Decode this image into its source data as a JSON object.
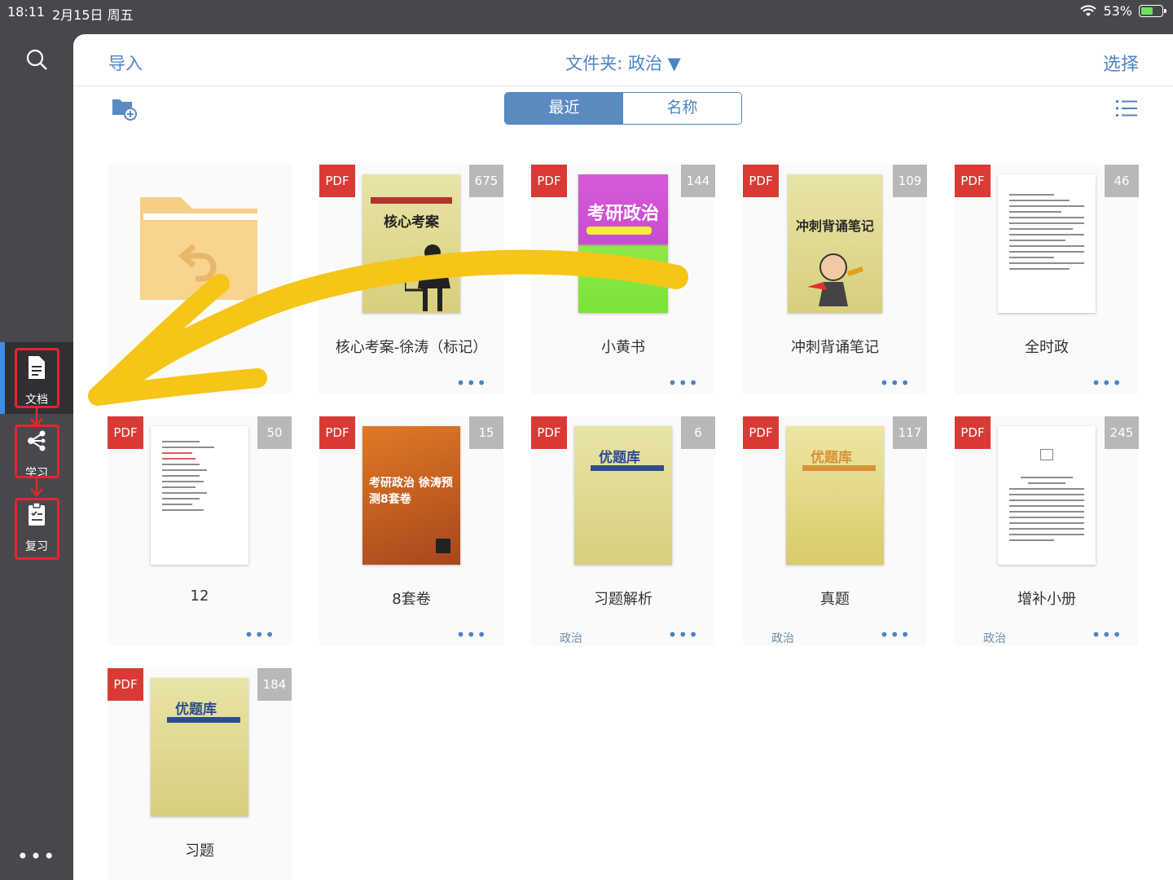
{
  "status": {
    "time": "18:11",
    "date": "2月15日 周五",
    "battery": "53%"
  },
  "sidebar": {
    "items": [
      {
        "label": "文档"
      },
      {
        "label": "学习"
      },
      {
        "label": "复习"
      }
    ],
    "more": "•••"
  },
  "toolbar": {
    "import": "导入",
    "folder": "文件夹: 政治 ▼",
    "select": "选择",
    "sort_recent": "最近",
    "sort_name": "名称"
  },
  "docs": [
    {
      "title": "核心考案-徐涛（标记）",
      "badge": "PDF",
      "pages": "675",
      "tag": "",
      "cover": "核心考案"
    },
    {
      "title": "小黄书",
      "badge": "PDF",
      "pages": "144",
      "tag": "",
      "cover": "考研政治"
    },
    {
      "title": "冲刺背诵笔记",
      "badge": "PDF",
      "pages": "109",
      "tag": "",
      "cover": "冲刺背诵笔记"
    },
    {
      "title": "全时政",
      "badge": "PDF",
      "pages": "46",
      "tag": "",
      "cover": ""
    },
    {
      "title": "12",
      "badge": "PDF",
      "pages": "50",
      "tag": "",
      "cover": ""
    },
    {
      "title": "8套卷",
      "badge": "PDF",
      "pages": "15",
      "tag": "",
      "cover": "考研政治 徐涛预测8套卷"
    },
    {
      "title": "习题解析",
      "badge": "PDF",
      "pages": "6",
      "tag": "政治",
      "cover": "优题库"
    },
    {
      "title": "真题",
      "badge": "PDF",
      "pages": "117",
      "tag": "政治",
      "cover": "优题库"
    },
    {
      "title": "增补小册",
      "badge": "PDF",
      "pages": "245",
      "tag": "政治",
      "cover": ""
    },
    {
      "title": "习题",
      "badge": "PDF",
      "pages": "184",
      "tag": "",
      "cover": "优题库"
    }
  ],
  "more_label": "•••",
  "colors": {
    "accent": "#4e84c4",
    "pdf_badge": "#d93a36",
    "annotation": "#f5c518",
    "highlight_box": "#e8232f"
  }
}
